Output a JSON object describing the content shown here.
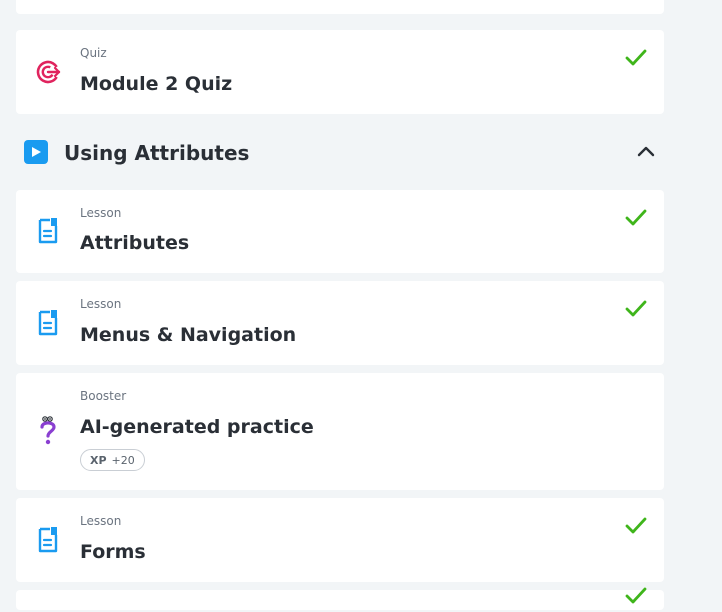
{
  "items": [
    {
      "kind": "",
      "title": ""
    },
    {
      "kind": "Quiz",
      "title": "Module 2 Quiz",
      "icon": "target-icon",
      "completed": true
    },
    {
      "kind": "Lesson",
      "title": "Attributes",
      "icon": "document-icon",
      "completed": true
    },
    {
      "kind": "Lesson",
      "title": "Menus & Navigation",
      "icon": "document-icon",
      "completed": true
    },
    {
      "kind": "Booster",
      "title": "AI-generated practice",
      "icon": "question-icon",
      "completed": false,
      "xp_label": "XP",
      "xp_value": "+20"
    },
    {
      "kind": "Lesson",
      "title": "Forms",
      "icon": "document-icon",
      "completed": true
    }
  ],
  "section": {
    "title": "Using Attributes",
    "icon": "play-icon",
    "expanded": true
  },
  "colors": {
    "background": "#f2f5f7",
    "check": "#3fb51b",
    "quiz_icon": "#e0245e",
    "doc_icon": "#1a9bf0",
    "question_icon": "#8a3fd1"
  }
}
